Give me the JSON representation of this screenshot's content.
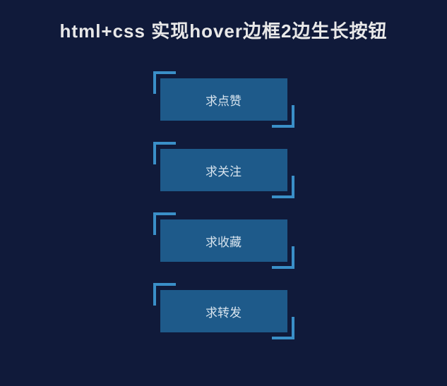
{
  "title": "html+css 实现hover边框2边生长按钮",
  "buttons": [
    {
      "label": "求点赞"
    },
    {
      "label": "求关注"
    },
    {
      "label": "求收藏"
    },
    {
      "label": "求转发"
    }
  ]
}
